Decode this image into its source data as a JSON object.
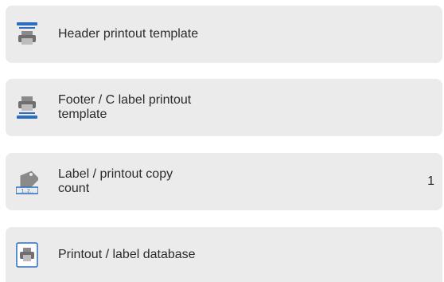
{
  "colors": {
    "row_background": "#ebebeb",
    "text": "#2b2b2b",
    "icon_blue": "#2a6fbf",
    "icon_gray": "#7a7a7a"
  },
  "items": [
    {
      "label": "Header printout template",
      "icon": "header-printout-icon"
    },
    {
      "label": "Footer / C label printout template",
      "icon": "footer-printout-icon"
    },
    {
      "label": "Label / printout copy\ncount",
      "icon": "copy-count-icon",
      "value": "1"
    },
    {
      "label": "Printout / label database",
      "icon": "printout-database-icon"
    }
  ]
}
